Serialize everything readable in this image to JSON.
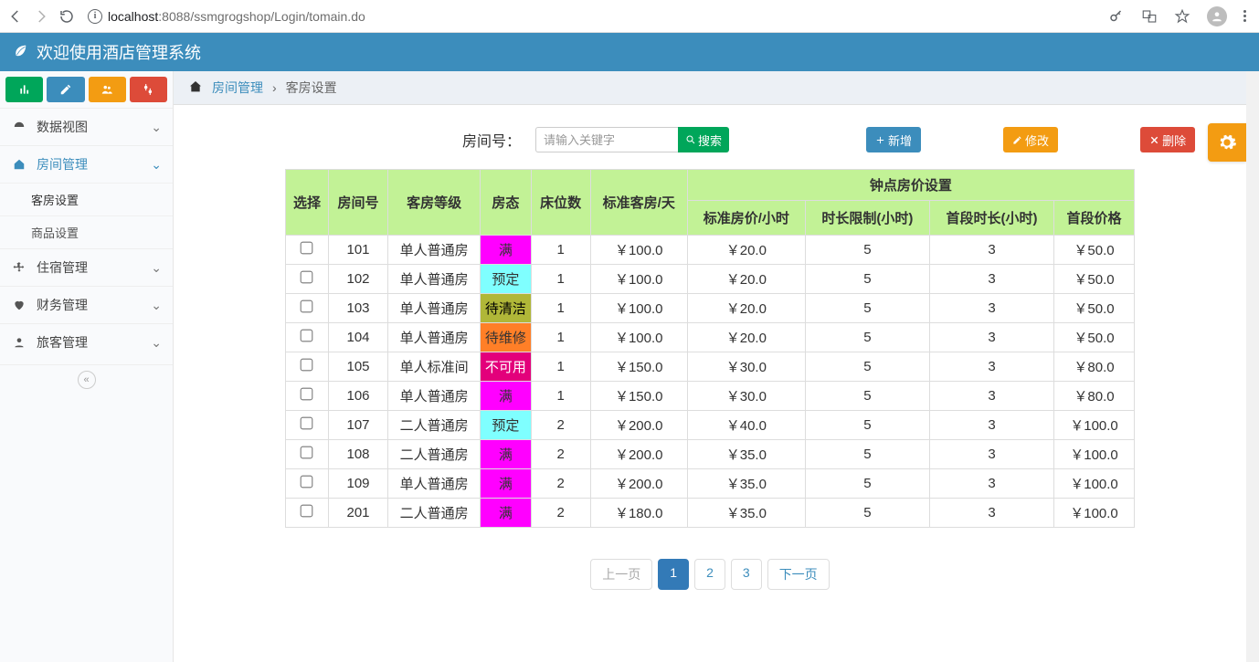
{
  "browser": {
    "url_host": "localhost",
    "url_port": ":8088",
    "url_path": "/ssmgrogshop/Login/tomain.do"
  },
  "app_title": "欢迎使用酒店管理系统",
  "breadcrumb": {
    "link": "房间管理",
    "sep": "›",
    "current": "客房设置"
  },
  "sidebar": {
    "items": [
      {
        "label": "数据视图"
      },
      {
        "label": "房间管理"
      },
      {
        "label": "住宿管理"
      },
      {
        "label": "财务管理"
      },
      {
        "label": "旅客管理"
      }
    ],
    "sub": [
      {
        "label": "客房设置"
      },
      {
        "label": "商品设置"
      }
    ]
  },
  "actions": {
    "room_label": "房间号：",
    "search_placeholder": "请输入关键字",
    "search": "搜索",
    "add": "新增",
    "edit": "修改",
    "del": "删除"
  },
  "table": {
    "group_header": "钟点房价设置",
    "headers": {
      "select": "选择",
      "room_no": "房间号",
      "grade": "客房等级",
      "status": "房态",
      "beds": "床位数",
      "std_day": "标准客房/天",
      "std_hour": "标准房价/小时",
      "limit": "时长限制(小时)",
      "first_dur": "首段时长(小时)",
      "first_price": "首段价格"
    },
    "rows": [
      {
        "room": "101",
        "grade": "单人普通房",
        "status": "满",
        "status_cls": "st-full",
        "beds": "1",
        "day": "￥100.0",
        "hour": "￥20.0",
        "limit": "5",
        "fd": "3",
        "fp": "￥50.0"
      },
      {
        "room": "102",
        "grade": "单人普通房",
        "status": "预定",
        "status_cls": "st-booked",
        "beds": "1",
        "day": "￥100.0",
        "hour": "￥20.0",
        "limit": "5",
        "fd": "3",
        "fp": "￥50.0"
      },
      {
        "room": "103",
        "grade": "单人普通房",
        "status": "待清洁",
        "status_cls": "st-clean",
        "beds": "1",
        "day": "￥100.0",
        "hour": "￥20.0",
        "limit": "5",
        "fd": "3",
        "fp": "￥50.0"
      },
      {
        "room": "104",
        "grade": "单人普通房",
        "status": "待维修",
        "status_cls": "st-repair",
        "beds": "1",
        "day": "￥100.0",
        "hour": "￥20.0",
        "limit": "5",
        "fd": "3",
        "fp": "￥50.0"
      },
      {
        "room": "105",
        "grade": "单人标准间",
        "status": "不可用",
        "status_cls": "st-na",
        "beds": "1",
        "day": "￥150.0",
        "hour": "￥30.0",
        "limit": "5",
        "fd": "3",
        "fp": "￥80.0"
      },
      {
        "room": "106",
        "grade": "单人普通房",
        "status": "满",
        "status_cls": "st-full",
        "beds": "1",
        "day": "￥150.0",
        "hour": "￥30.0",
        "limit": "5",
        "fd": "3",
        "fp": "￥80.0"
      },
      {
        "room": "107",
        "grade": "二人普通房",
        "status": "预定",
        "status_cls": "st-booked",
        "beds": "2",
        "day": "￥200.0",
        "hour": "￥40.0",
        "limit": "5",
        "fd": "3",
        "fp": "￥100.0"
      },
      {
        "room": "108",
        "grade": "二人普通房",
        "status": "满",
        "status_cls": "st-full",
        "beds": "2",
        "day": "￥200.0",
        "hour": "￥35.0",
        "limit": "5",
        "fd": "3",
        "fp": "￥100.0"
      },
      {
        "room": "109",
        "grade": "单人普通房",
        "status": "满",
        "status_cls": "st-full",
        "beds": "2",
        "day": "￥200.0",
        "hour": "￥35.0",
        "limit": "5",
        "fd": "3",
        "fp": "￥100.0"
      },
      {
        "room": "201",
        "grade": "二人普通房",
        "status": "满",
        "status_cls": "st-full",
        "beds": "2",
        "day": "￥180.0",
        "hour": "￥35.0",
        "limit": "5",
        "fd": "3",
        "fp": "￥100.0"
      }
    ]
  },
  "pager": {
    "prev": "上一页",
    "p1": "1",
    "p2": "2",
    "p3": "3",
    "next": "下一页"
  }
}
